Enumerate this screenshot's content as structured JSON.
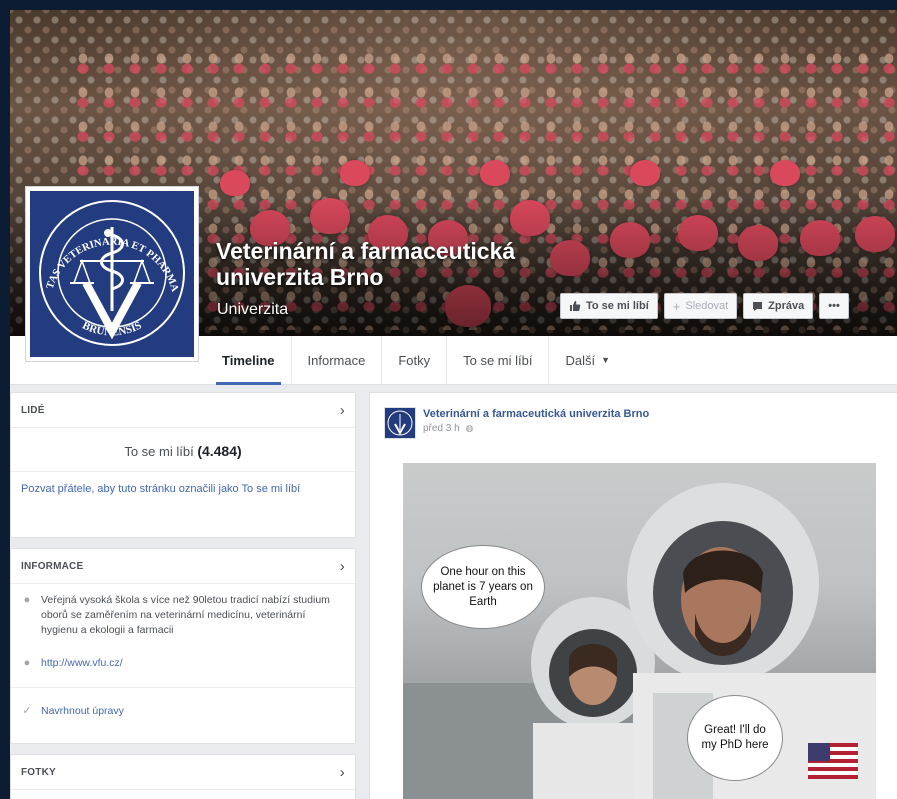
{
  "page": {
    "name": "Veterinární a farmaceutická univerzita Brno",
    "category": "Univerzita",
    "logo_text_top": "UNIVERSITAS VETERINARIA ET PHARMACEUTICA",
    "logo_text_bottom": "BRUNENSIS"
  },
  "cover_actions": {
    "like": "To se mi líbí",
    "follow": "Sledovat",
    "message": "Zpráva",
    "more": "•••"
  },
  "tabs": [
    {
      "label": "Timeline"
    },
    {
      "label": "Informace"
    },
    {
      "label": "Fotky"
    },
    {
      "label": "To se mi líbí"
    },
    {
      "label": "Další"
    }
  ],
  "people": {
    "header": "LIDÉ",
    "likes_label": "To se mi líbí",
    "likes_count": "(4.484)",
    "invite_text": "Pozvat přátele, aby tuto stránku označili jako To se mi líbí"
  },
  "about": {
    "header": "INFORMACE",
    "description": "Veřejná vysoká škola s více než 90letou tradicí nabízí studium oborů se zaměřením na veterinární medicínu, veterinární hygienu a ekologii a farmacii",
    "website": "http://www.vfu.cz/",
    "suggest": "Navrhnout úpravy"
  },
  "photos": {
    "header": "FOTKY"
  },
  "post": {
    "author": "Veterinární a farmaceutická univerzita Brno",
    "time": "před 3 h",
    "bubble_left": "One hour on this planet is 7 years on Earth",
    "bubble_right": "Great! I'll do my PhD here"
  },
  "colors": {
    "brand_blue": "#4267b2",
    "link_blue": "#365899",
    "logo_blue": "#233c80",
    "page_bg": "#0b1c33"
  }
}
